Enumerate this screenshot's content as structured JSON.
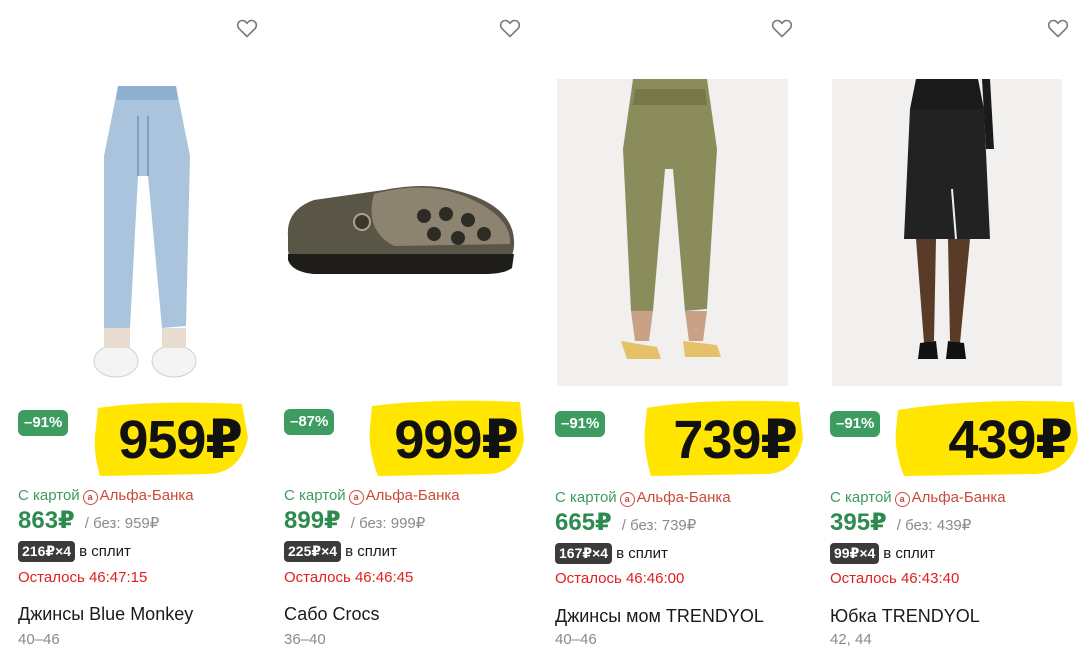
{
  "products": [
    {
      "image_icon": "jeans-photo",
      "discount": "–91%",
      "price": "959₽",
      "bank_prefix": "С картой",
      "bank_icon": "а",
      "bank_name": "Альфа-Банка",
      "card_price": "863₽",
      "old_price": "/ без: 959₽",
      "split_badge": "216₽×4",
      "split_text": "в сплит",
      "timer": "Осталось 46:47:15",
      "title": "Джинсы Blue Monkey",
      "sizes": "40–46"
    },
    {
      "image_icon": "clogs-photo",
      "discount": "–87%",
      "price": "999₽",
      "bank_prefix": "С картой",
      "bank_icon": "а",
      "bank_name": "Альфа-Банка",
      "card_price": "899₽",
      "old_price": "/ без: 999₽",
      "split_badge": "225₽×4",
      "split_text": "в сплит",
      "timer": "Осталось 46:46:45",
      "title": "Сабо Crocs",
      "sizes": "36–40"
    },
    {
      "image_icon": "mom-jeans-photo",
      "discount": "–91%",
      "price": "739₽",
      "bank_prefix": "С картой",
      "bank_icon": "а",
      "bank_name": "Альфа-Банка",
      "card_price": "665₽",
      "old_price": "/ без: 739₽",
      "split_badge": "167₽×4",
      "split_text": "в сплит",
      "timer": "Осталось 46:46:00",
      "title": "Джинсы мом TRENDYOL",
      "sizes": "40–46"
    },
    {
      "image_icon": "skirt-photo",
      "discount": "–91%",
      "price": "439₽",
      "bank_prefix": "С картой",
      "bank_icon": "а",
      "bank_name": "Альфа-Банка",
      "card_price": "395₽",
      "old_price": "/ без: 439₽",
      "split_badge": "99₽×4",
      "split_text": "в сплит",
      "timer": "Осталось 46:43:40",
      "title": "Юбка TRENDYOL",
      "sizes": "42, 44"
    }
  ],
  "colors": {
    "discount_bg": "#3d9c5f",
    "price_highlight": "#ffe500",
    "card_price": "#2f8a4f",
    "timer": "#e02020",
    "bank_name": "#c94a3a"
  },
  "icons": {
    "favorite": "heart-icon",
    "bank": "alfa-bank-icon"
  }
}
